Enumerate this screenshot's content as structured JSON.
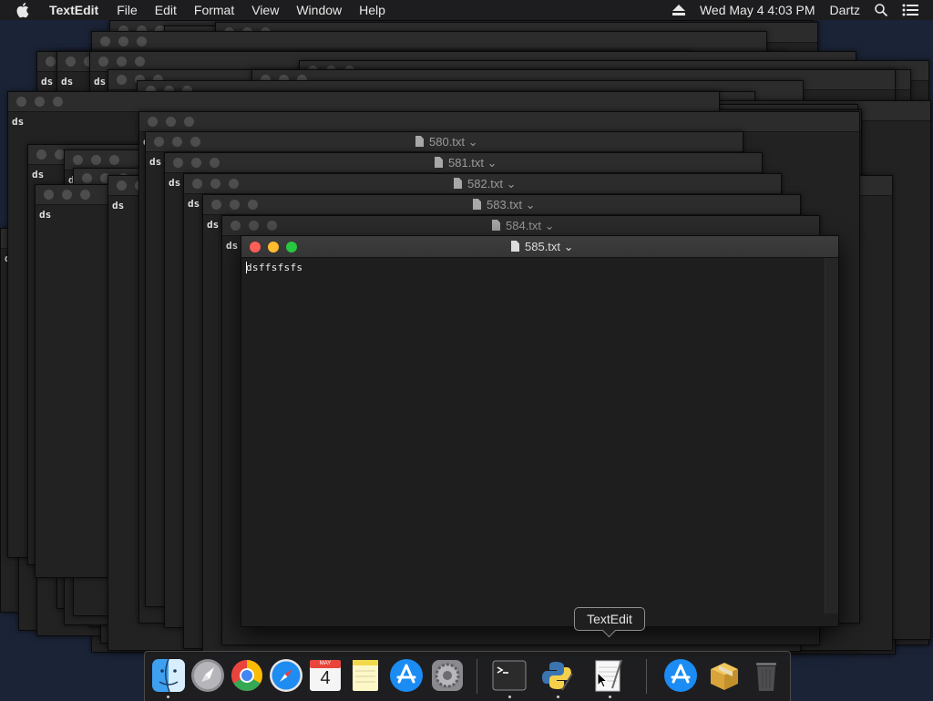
{
  "menubar": {
    "app_name": "TextEdit",
    "menus": [
      "File",
      "Edit",
      "Format",
      "View",
      "Window",
      "Help"
    ],
    "datetime": "Wed May 4  4:03 PM",
    "user": "Dartz"
  },
  "front_window": {
    "title": "585.txt",
    "content": "dsffsfsfs"
  },
  "background_windows": {
    "titles": [
      "580.txt",
      "581.txt",
      "582.txt",
      "583.txt",
      "584.txt"
    ],
    "snippet": "ds"
  },
  "tooltip": "TextEdit",
  "dock": {
    "apps": [
      "Finder",
      "Launchpad",
      "Google Chrome",
      "Safari",
      "Calendar",
      "Notes",
      "App Store",
      "System Preferences",
      "Terminal",
      "Python Launcher",
      "TextEdit",
      "App Store",
      "Archive",
      "Trash"
    ],
    "calendar": {
      "month": "MAY",
      "day": "4"
    }
  }
}
